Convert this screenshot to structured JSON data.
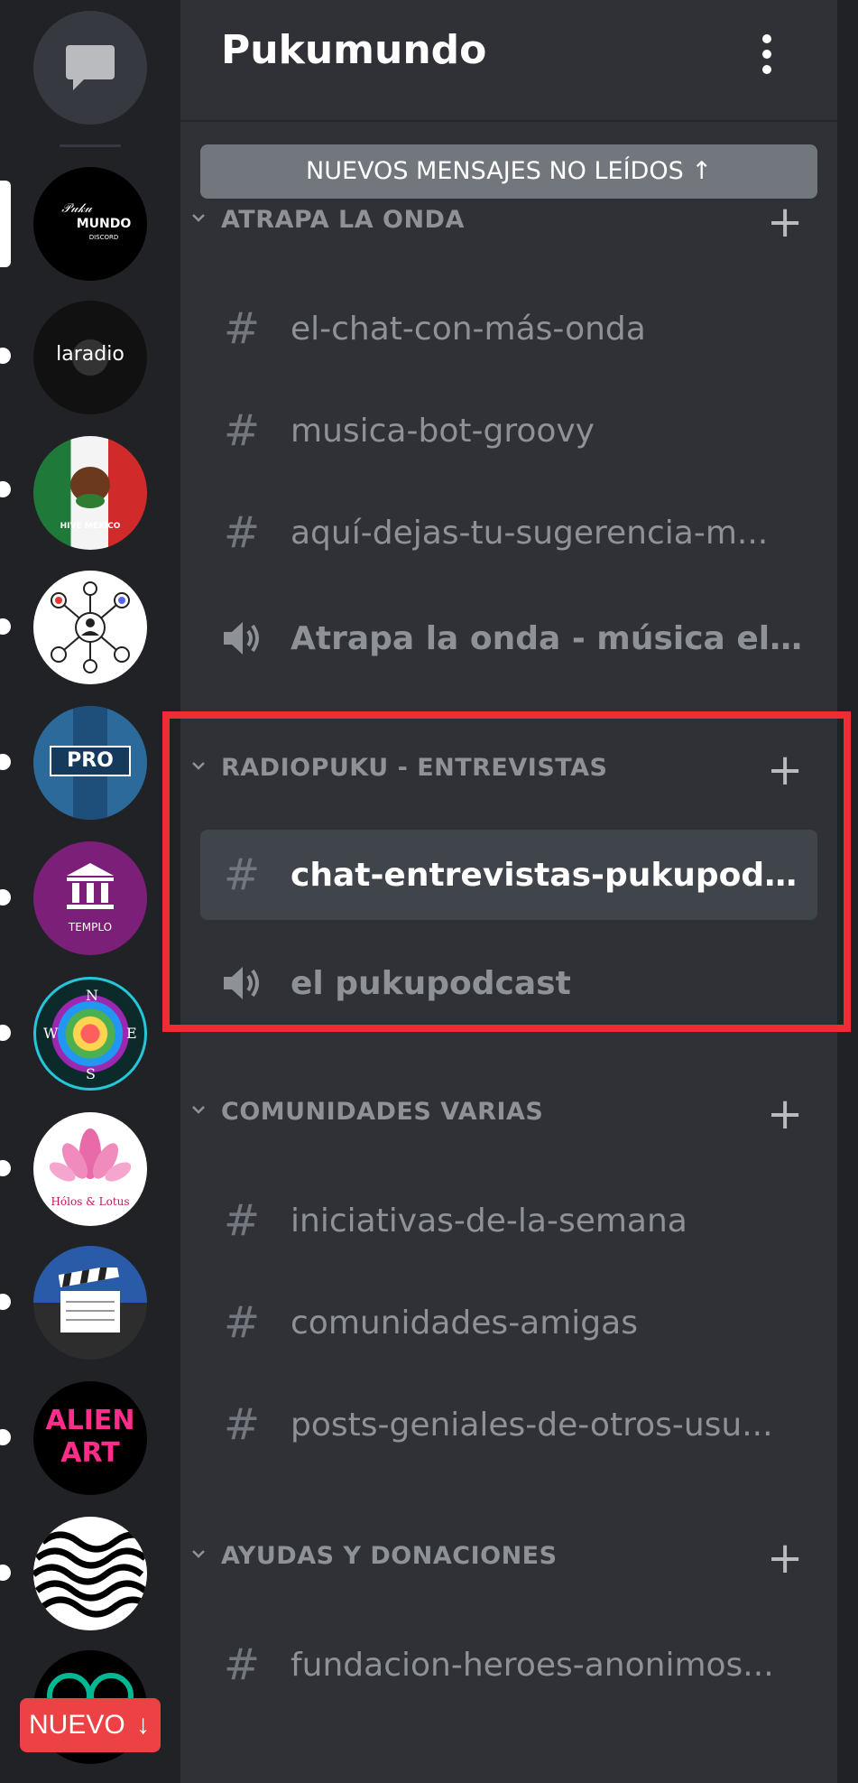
{
  "server": {
    "name": "Pukumundo",
    "menu_icon": "kebab-menu-icon"
  },
  "unread_banner": {
    "label": "NUEVOS MENSAJES NO LEÍDOS",
    "icon": "arrow-up-icon"
  },
  "categories": [
    {
      "label": "ATRAPA LA ONDA",
      "channels": [
        {
          "type": "text",
          "name": "el-chat-con-más-onda"
        },
        {
          "type": "text",
          "name": "musica-bot-groovy"
        },
        {
          "type": "text",
          "name": "aquí-dejas-tu-sugerencia-m..."
        },
        {
          "type": "voice",
          "name": "Atrapa la onda - música elec..."
        }
      ]
    },
    {
      "label": "RADIOPUKU - ENTREVISTAS",
      "channels": [
        {
          "type": "text",
          "name": "chat-entrevistas-pukupodcast",
          "active": true
        },
        {
          "type": "voice",
          "name": "el pukupodcast"
        }
      ]
    },
    {
      "label": "COMUNIDADES VARIAS",
      "channels": [
        {
          "type": "text",
          "name": "iniciativas-de-la-semana"
        },
        {
          "type": "text",
          "name": "comunidades-amigas"
        },
        {
          "type": "text",
          "name": "posts-geniales-de-otros-usu..."
        }
      ]
    },
    {
      "label": "AYUDAS Y DONACIONES",
      "channels": [
        {
          "type": "text",
          "name": "fundacion-heroes-anonimos..."
        }
      ]
    }
  ],
  "server_rail": {
    "servers": [
      {
        "name": "Pukumundo",
        "logo_text": "MUNDO",
        "logo_sub": "DISCORD",
        "bg": "#000000",
        "selected": true
      },
      {
        "name": "laradio",
        "logo_text": "laradio",
        "bg": "#111111"
      },
      {
        "name": "Hive Mexico",
        "logo_text": "HIVE MEXICO",
        "bg": "#1f7a3a"
      },
      {
        "name": "Network",
        "bg": "#ffffff"
      },
      {
        "name": "Pro",
        "logo_text": "PRO",
        "bg": "#1e4f7a"
      },
      {
        "name": "Templo",
        "logo_text": "TEMPLO",
        "bg": "#7b1f78"
      },
      {
        "name": "Compass",
        "compass_letters": [
          "N",
          "W",
          "E",
          "S"
        ],
        "bg": "#0d2a2a"
      },
      {
        "name": "Holos & Lotus",
        "logo_text": "Hólos & Lotus",
        "bg": "#ffffff"
      },
      {
        "name": "Cine",
        "bg": "#2a5ba8"
      },
      {
        "name": "Alien Art",
        "logo_text": "ALIEN ART",
        "bg": "#000000"
      },
      {
        "name": "Waves",
        "bg": "#ffffff"
      },
      {
        "name": "Partial",
        "bg": "#000000"
      }
    ],
    "new_badge": {
      "label": "NUEVO",
      "icon": "arrow-down-icon"
    }
  },
  "colors": {
    "highlight": "#ec2d33",
    "rail_bg": "#202225",
    "column_bg": "#2f3136",
    "active_channel_bg": "#40444b",
    "badge_red": "#ed4245"
  }
}
